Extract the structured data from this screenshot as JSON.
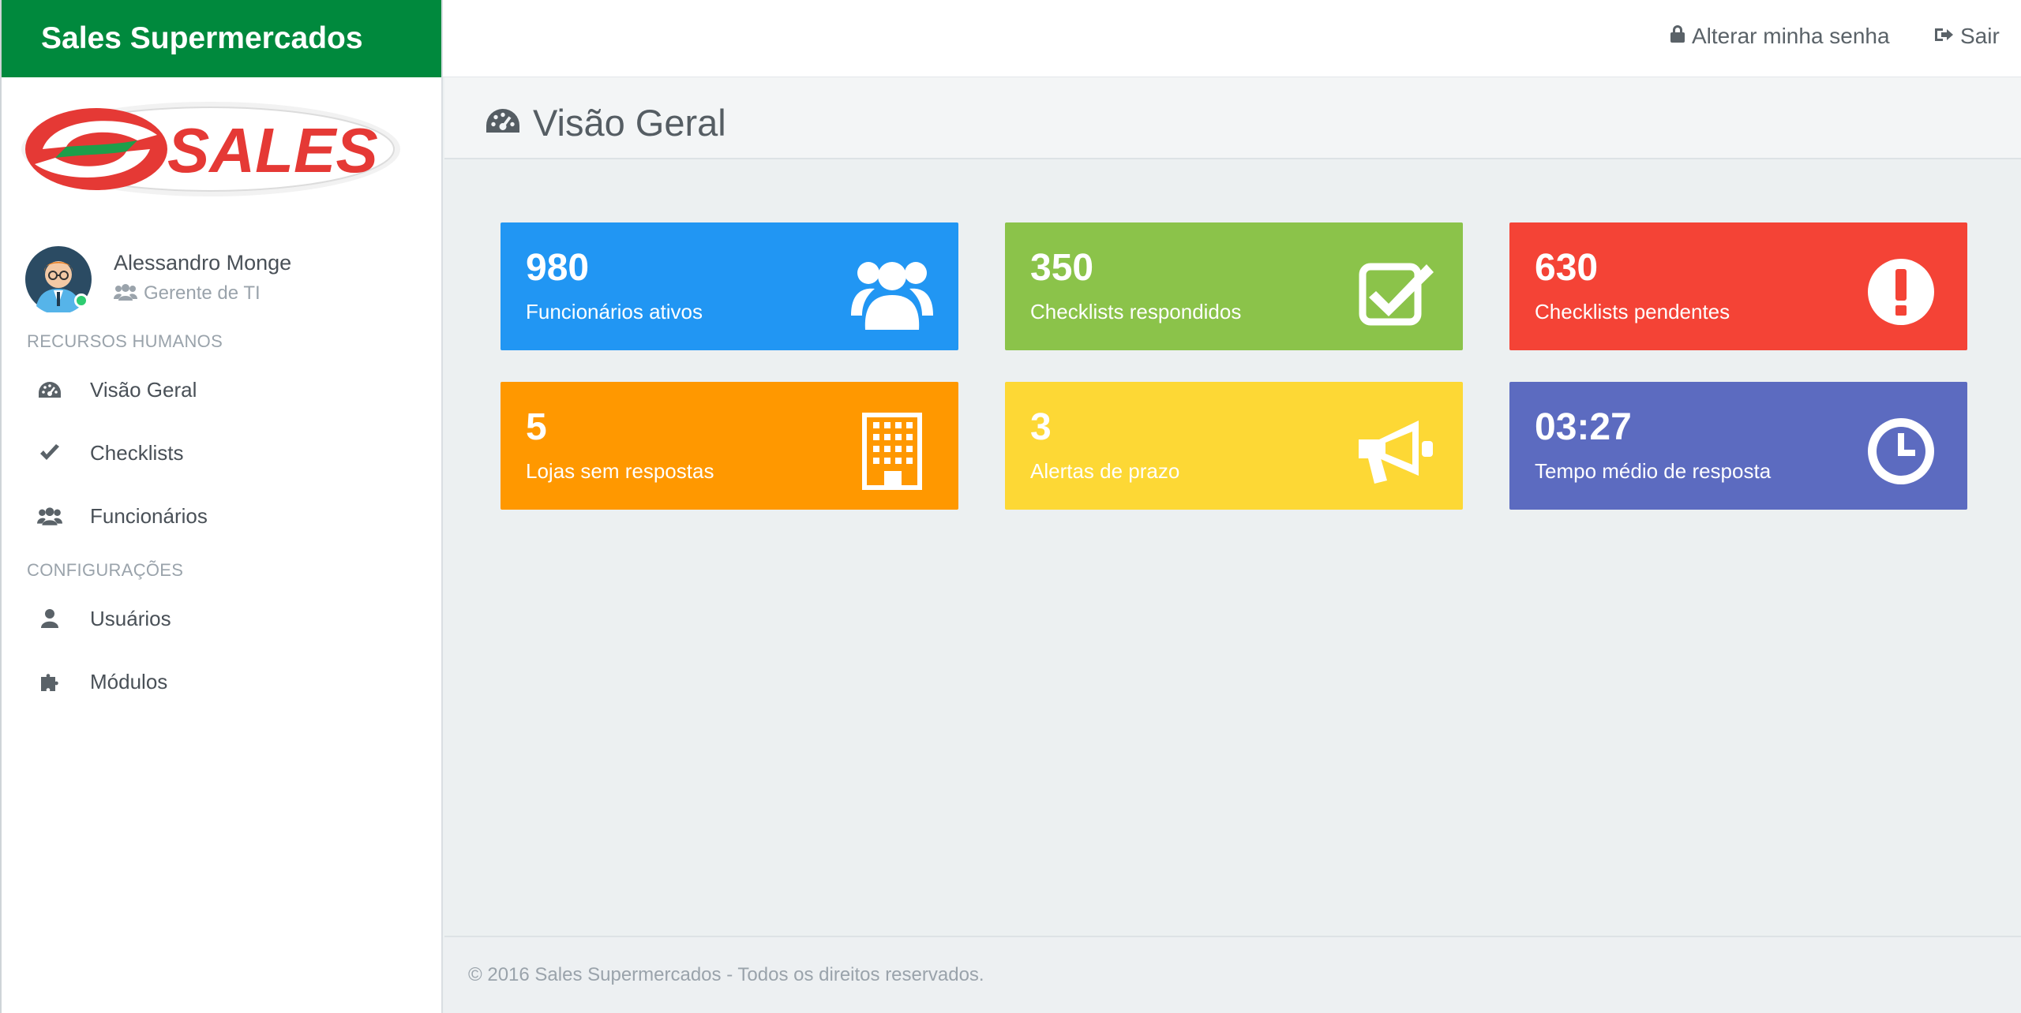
{
  "app": {
    "brand": "Sales Supermercados",
    "logo_text": "SALES"
  },
  "topbar": {
    "change_password": "Alterar minha senha",
    "logout": "Sair"
  },
  "user": {
    "name": "Alessandro Monge",
    "role": "Gerente de TI"
  },
  "sidebar": {
    "sections": [
      {
        "title": "RECURSOS HUMANOS",
        "items": [
          {
            "label": "Visão Geral",
            "icon": "dashboard-icon"
          },
          {
            "label": "Checklists",
            "icon": "check-icon"
          },
          {
            "label": "Funcionários",
            "icon": "users-icon"
          }
        ]
      },
      {
        "title": "CONFIGURAÇÕES",
        "items": [
          {
            "label": "Usuários",
            "icon": "user-icon"
          },
          {
            "label": "Módulos",
            "icon": "puzzle-icon"
          }
        ]
      }
    ]
  },
  "page": {
    "title": "Visão Geral"
  },
  "tiles": [
    {
      "value": "980",
      "label": "Funcionários ativos",
      "color": "#2196f3",
      "icon": "users-icon"
    },
    {
      "value": "350",
      "label": "Checklists respondidos",
      "color": "#8bc34a",
      "icon": "check-square-icon"
    },
    {
      "value": "630",
      "label": "Checklists pendentes",
      "color": "#f44336",
      "icon": "exclamation-circle-icon"
    },
    {
      "value": "5",
      "label": "Lojas sem respostas",
      "color": "#ff9800",
      "icon": "building-icon"
    },
    {
      "value": "3",
      "label": "Alertas de prazo",
      "color": "#fdd835",
      "icon": "megaphone-icon"
    },
    {
      "value": "03:27",
      "label": "Tempo médio de resposta",
      "color": "#5c6bc0",
      "icon": "clock-icon"
    }
  ],
  "footer": {
    "text": "© 2016 Sales Supermercados - Todos os direitos reservados."
  },
  "colors": {
    "brand_green": "#00893d",
    "logo_red": "#e53935"
  }
}
